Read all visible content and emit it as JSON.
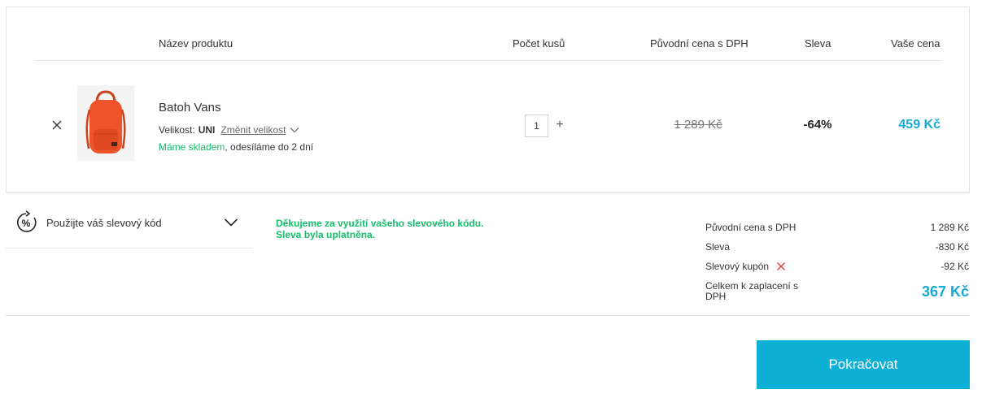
{
  "table_header": {
    "product_name": "Název produktu",
    "quantity": "Počet kusů",
    "original_price": "Původní cena s DPH",
    "discount": "Sleva",
    "your_price": "Vaše cena"
  },
  "item": {
    "name": "Batoh Vans",
    "size_label": "Velikost:",
    "size_value": "UNI",
    "change_size": "Změnit velikost",
    "stock_status": "Máme skladem",
    "shipping_note": ", odesíláme do 2 dní",
    "quantity": "1",
    "quantity_plus": "+",
    "original_price": "1 289 Kč",
    "discount": "-64%",
    "your_price": "459 Kč",
    "image_color": "#f0542a"
  },
  "coupon": {
    "label": "Použijte váš slevový kód",
    "thanks_line1": "Děkujeme za využití vašeho slevového kódu.",
    "thanks_line2": "Sleva byla uplatněna."
  },
  "summary": {
    "original_label": "Původní cena s DPH",
    "original_value": "1 289 Kč",
    "discount_label": "Sleva",
    "discount_value": "-830 Kč",
    "coupon_label": "Slevový kupón",
    "coupon_value": "-92 Kč",
    "total_label": "Celkem k zaplacení s DPH",
    "total_value": "367 Kč"
  },
  "continue_label": "Pokračovat",
  "colors": {
    "accent": "#0fb0d5",
    "price": "#17a9d3",
    "success": "#14c06b",
    "remove": "#e53935"
  }
}
